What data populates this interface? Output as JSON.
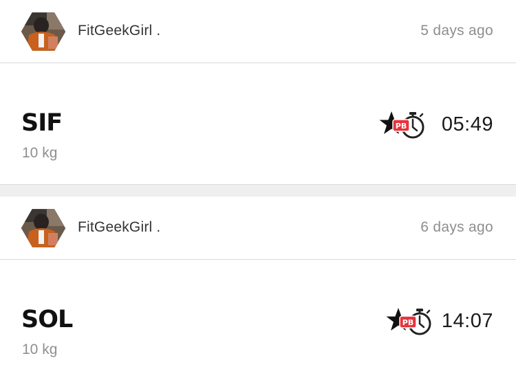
{
  "feed": {
    "entries": [
      {
        "user": "FitGeekGirl .",
        "time_ago": "5 days ago",
        "workout_name": "SIF",
        "load": "10 kg",
        "time": "05:49",
        "badge": "PB",
        "icons": [
          "avatar",
          "star-icon",
          "stopwatch-icon"
        ]
      },
      {
        "user": "FitGeekGirl .",
        "time_ago": "6 days ago",
        "workout_name": "SOL",
        "load": "10 kg",
        "time": "14:07",
        "badge": "PB",
        "icons": [
          "avatar",
          "star-icon",
          "stopwatch-icon"
        ]
      }
    ]
  },
  "colors": {
    "badge_red": "#e8333c",
    "text_dark": "#111111",
    "text_muted": "#8e8e8e",
    "separator": "#d9d9d9",
    "band": "#efefef"
  }
}
